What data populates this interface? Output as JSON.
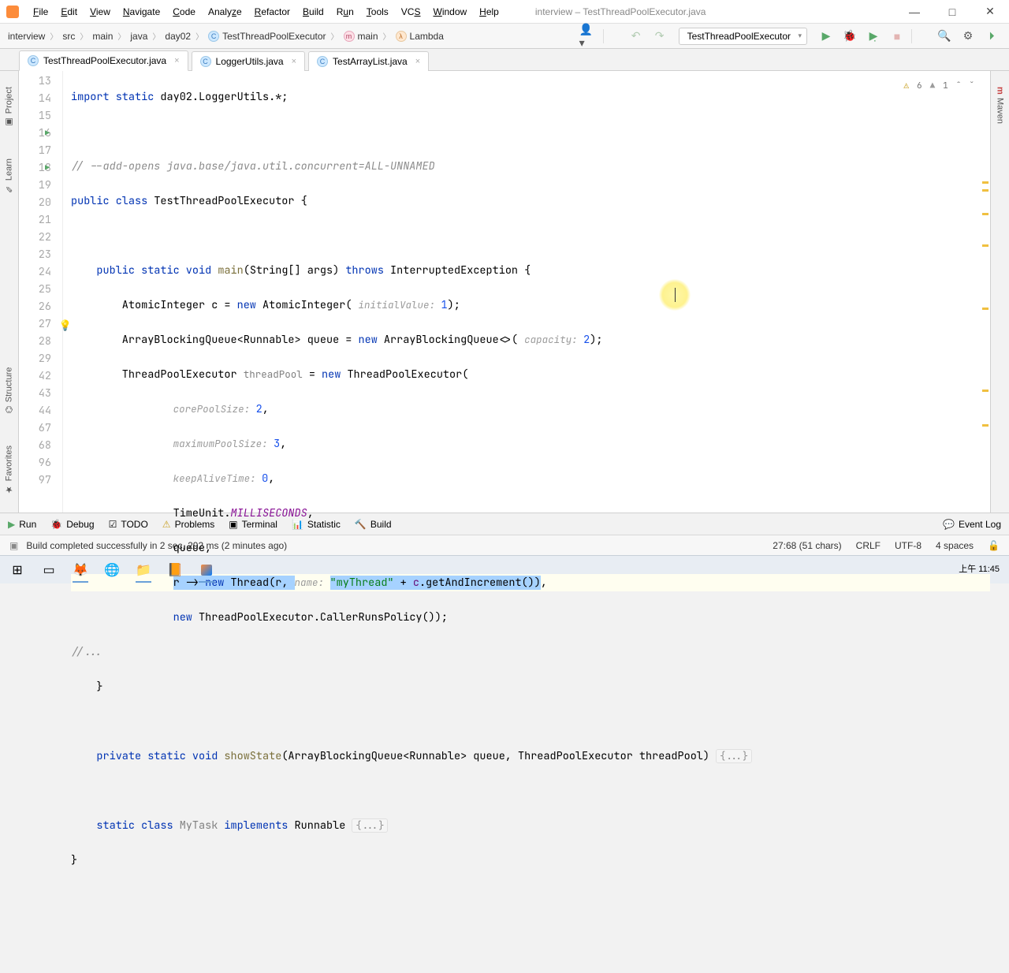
{
  "titlebar": {
    "title": "interview – TestThreadPoolExecutor.java",
    "menu": [
      "File",
      "Edit",
      "View",
      "Navigate",
      "Code",
      "Analyze",
      "Refactor",
      "Build",
      "Run",
      "Tools",
      "VCS",
      "Window",
      "Help"
    ]
  },
  "breadcrumbs": [
    "interview",
    "src",
    "main",
    "java",
    "day02",
    "TestThreadPoolExecutor",
    "main",
    "Lambda"
  ],
  "run_config": "TestThreadPoolExecutor",
  "tabs": [
    {
      "label": "TestThreadPoolExecutor.java",
      "active": true
    },
    {
      "label": "LoggerUtils.java",
      "active": false
    },
    {
      "label": "TestArrayList.java",
      "active": false
    }
  ],
  "left_rail": [
    "Project",
    "Learn",
    "Structure",
    "Favorites"
  ],
  "right_rail": [
    "Maven"
  ],
  "inspection": {
    "warnings": "6",
    "weak": "1"
  },
  "gutter_lines": [
    "13",
    "14",
    "15",
    "16",
    "17",
    "18",
    "19",
    "20",
    "21",
    "22",
    "23",
    "24",
    "25",
    "26",
    "27",
    "28",
    "29",
    "42",
    "43",
    "44",
    "67",
    "68",
    "96",
    "97"
  ],
  "code": {
    "l13_a": "import static ",
    "l13_b": "day02.LoggerUtils.*;",
    "l15": "// --add-opens java.base/java.util.concurrent=ALL-UNNAMED",
    "l16_a": "public class ",
    "l16_b": "TestThreadPoolExecutor {",
    "l18_a": "    public static void ",
    "l18_b": "main",
    "l18_c": "(String[] args) ",
    "l18_d": "throws ",
    "l18_e": "InterruptedException {",
    "l19_a": "        AtomicInteger c = ",
    "l19_b": "new ",
    "l19_c": "AtomicInteger( ",
    "l19_h": "initialValue: ",
    "l19_d": "1",
    "l19_e": ");",
    "l20_a": "        ArrayBlockingQueue<Runnable> queue = ",
    "l20_b": "new ",
    "l20_c": "ArrayBlockingQueue<>( ",
    "l20_h": "capacity: ",
    "l20_d": "2",
    "l20_e": ");",
    "l21_a": "        ThreadPoolExecutor ",
    "l21_p": "threadPool",
    "l21_b": " = ",
    "l21_c": "new ",
    "l21_d": "ThreadPoolExecutor(",
    "l22_h": "corePoolSize: ",
    "l22_v": "2",
    "l22_e": ",",
    "l23_h": "maximumPoolSize: ",
    "l23_v": "3",
    "l23_e": ",",
    "l24_h": "keepAliveTime: ",
    "l24_v": "0",
    "l24_e": ",",
    "l25_a": "                TimeUnit.",
    "l25_b": "MILLISECONDS",
    "l25_c": ",",
    "l26": "                queue,",
    "l27_a": "r -> ",
    "l27_b": "new ",
    "l27_c": "Thread(r, ",
    "l27_h": "name: ",
    "l27_s": "\"myThread\"",
    "l27_d": " + ",
    "l27_e": "c",
    "l27_f": ".getAndIncrement())",
    "l27_g": ",",
    "l28_a": "                ",
    "l28_b": "new ",
    "l28_c": "ThreadPoolExecutor.CallerRunsPolicy());",
    "l29": "//...",
    "l42": "    }",
    "l44_a": "    private static void ",
    "l44_b": "showState",
    "l44_c": "(ArrayBlockingQueue<Runnable> queue, ThreadPoolExecutor threadPool) ",
    "l44_d": "{...}",
    "l68_a": "    static class ",
    "l68_b": "MyTask ",
    "l68_c": "implements ",
    "l68_d": "Runnable ",
    "l68_e": "{...}",
    "l96": "}"
  },
  "bottom": {
    "run": "Run",
    "debug": "Debug",
    "todo": "TODO",
    "problems": "Problems",
    "terminal": "Terminal",
    "statistic": "Statistic",
    "build": "Build",
    "eventlog": "Event Log"
  },
  "status": {
    "msg": "Build completed successfully in 2 sec, 292 ms (2 minutes ago)",
    "pos": "27:68 (51 chars)",
    "sep": "CRLF",
    "enc": "UTF-8",
    "indent": "4 spaces"
  },
  "clock": {
    "time": "上午 11:45"
  }
}
